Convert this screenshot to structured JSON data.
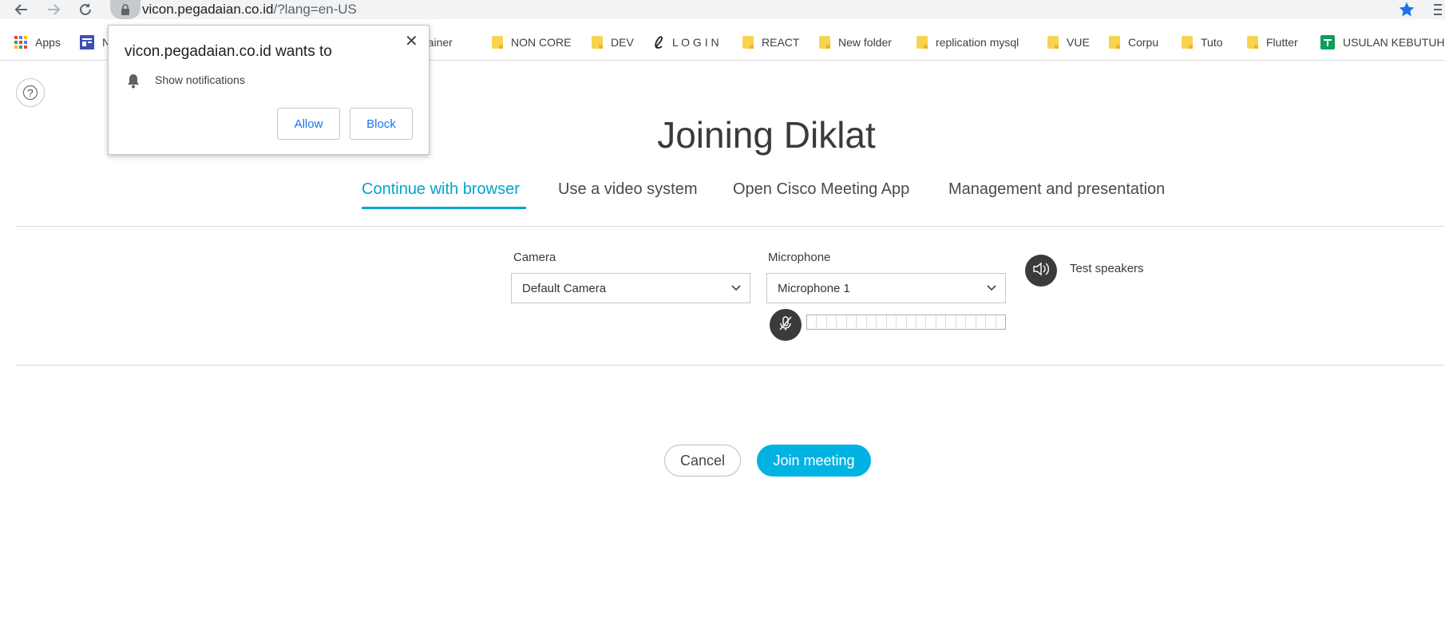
{
  "browser": {
    "url_host": "vicon.pegadaian.co.id",
    "url_rest": "/?lang=en-US",
    "bookmarks": [
      {
        "label": "Apps",
        "icon": "apps-grid-icon"
      },
      {
        "label": "N",
        "icon": "dashboard-icon"
      },
      {
        "label": "Portainer",
        "icon": "folder-icon"
      },
      {
        "label": "NON CORE",
        "icon": "folder-icon"
      },
      {
        "label": "DEV",
        "icon": "folder-icon"
      },
      {
        "label": "L O G I N",
        "icon": "script-l-icon"
      },
      {
        "label": "REACT",
        "icon": "folder-icon"
      },
      {
        "label": "New folder",
        "icon": "folder-icon"
      },
      {
        "label": "replication mysql",
        "icon": "folder-icon"
      },
      {
        "label": "VUE",
        "icon": "folder-icon"
      },
      {
        "label": "Corpu",
        "icon": "folder-icon"
      },
      {
        "label": "Tuto",
        "icon": "folder-icon"
      },
      {
        "label": "Flutter",
        "icon": "folder-icon"
      },
      {
        "label": "USULAN KEBUTUH...",
        "icon": "sheets-icon"
      }
    ]
  },
  "popup": {
    "title": "vicon.pegadaian.co.id wants to",
    "permission": "Show notifications",
    "allow_label": "Allow",
    "block_label": "Block",
    "close_glyph": "✕"
  },
  "page": {
    "help_glyph": "?",
    "title": "Joining Diklat",
    "tabs": [
      {
        "label": "Continue with browser",
        "active": true
      },
      {
        "label": "Use a video system",
        "active": false
      },
      {
        "label": "Open Cisco Meeting App",
        "active": false
      },
      {
        "label": "Management and presentation",
        "active": false
      }
    ],
    "camera_label": "Camera",
    "camera_value": "Default Camera",
    "microphone_label": "Microphone",
    "microphone_value": "Microphone 1",
    "mic_level": 0,
    "test_speakers_label": "Test speakers",
    "cancel_label": "Cancel",
    "join_label": "Join meeting"
  },
  "colors": {
    "accent": "#00a4d3",
    "join_button": "#00b3e3",
    "popup_link": "#1a73e8"
  }
}
